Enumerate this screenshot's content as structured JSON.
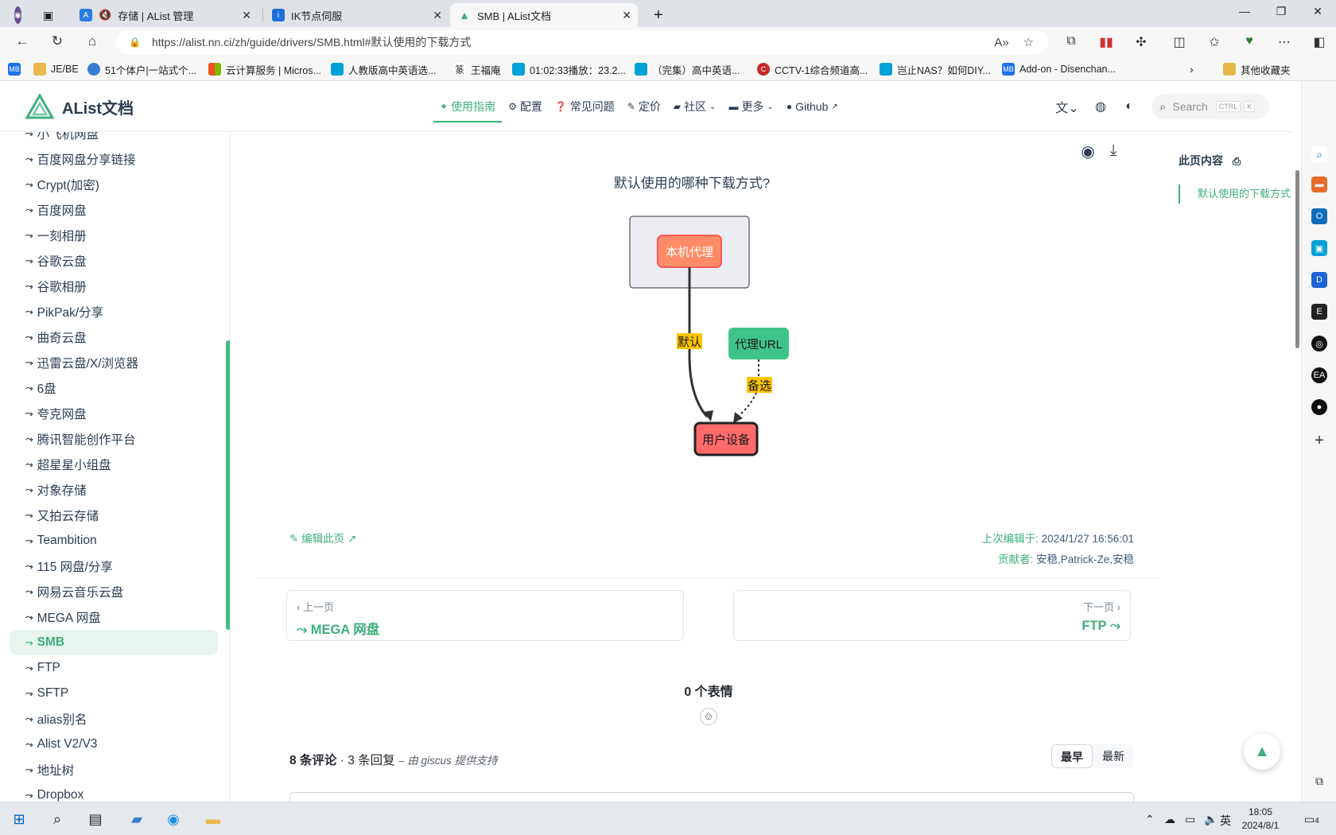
{
  "browser": {
    "tabs": [
      {
        "label": "存储 | AList 管理",
        "active": false
      },
      {
        "label": "IK节点伺服",
        "active": false
      },
      {
        "label": "SMB | AList文档",
        "active": true
      }
    ],
    "url": "https://alist.nn.ci/zh/guide/drivers/SMB.html#默认使用的下载方式",
    "bookmarks": [
      "JE/BE",
      "51个体户|一站式个...",
      "云计算服务 | Micros...",
      "人教版高中英语选...",
      "王福庵",
      "01:02:33播放：23.2...",
      "（完集）高中英语...",
      "CCTV-1综合频道高...",
      "岂止NAS？如何DIY...",
      "Add-on - Disenchan...",
      "其他收藏夹"
    ],
    "bookmark_badge": "MB"
  },
  "site": {
    "logo_text": "AList文档",
    "nav": [
      {
        "label": "使用指南",
        "icon": "lightbulb-icon",
        "active": true
      },
      {
        "label": "配置",
        "icon": "gear-icon"
      },
      {
        "label": "常见问题",
        "icon": "question-icon"
      },
      {
        "label": "定价",
        "icon": "tag-icon"
      },
      {
        "label": "社区",
        "icon": "chat-icon",
        "dropdown": true
      },
      {
        "label": "更多",
        "icon": "message-icon",
        "dropdown": true
      },
      {
        "label": "Github",
        "icon": "github-icon",
        "external": true
      }
    ],
    "search_placeholder": "Search",
    "search_kbd_1": "CTRL",
    "search_kbd_2": "K"
  },
  "sidebar": {
    "items": [
      "小飞机网盘",
      "百度网盘分享链接",
      "Crypt(加密)",
      "百度网盘",
      "一刻相册",
      "谷歌云盘",
      "谷歌相册",
      "PikPak/分享",
      "曲奇云盘",
      "迅雷云盘/X/浏览器",
      "6盘",
      "夸克网盘",
      "腾讯智能创作平台",
      "超星星小组盘",
      "对象存储",
      "又拍云存储",
      "Teambition",
      "115 网盘/分享",
      "网易云音乐云盘",
      "MEGA 网盘",
      "SMB",
      "FTP",
      "SFTP",
      "alias别名",
      "Alist V2/V3",
      "地址树",
      "Dropbox"
    ],
    "active": "SMB"
  },
  "content": {
    "diagram": {
      "title": "默认使用的哪种下载方式?",
      "node_proxy": "本机代理",
      "node_url": "代理URL",
      "node_user": "用户设备",
      "edge_default": "默认",
      "edge_alt": "备选",
      "colors": {
        "proxy": "#ff8c66",
        "url": "#3ec48a",
        "user": "#ff6b6b",
        "label": "#ffc400"
      }
    },
    "edit_link": "编辑此页",
    "last_updated_label": "上次编辑于:",
    "last_updated": "2024/1/27 16:56:01",
    "contributors_label": "贡献者:",
    "contributors": "安稳,Patrick-Ze,安稳",
    "prev_label": "‹ 上一页",
    "prev_title": "MEGA 网盘",
    "next_label": "下一页 ›",
    "next_title": "FTP",
    "reactions": "0 个表情",
    "comments_count": "8 条评论",
    "replies_count": "3 条回复",
    "powered_by": "– 由 giscus 提供支持",
    "sort_oldest": "最早",
    "sort_newest": "最新"
  },
  "toc": {
    "title": "此页内容",
    "items": [
      "默认使用的下载方式"
    ]
  },
  "taskbar": {
    "time": "18:05",
    "date": "2024/8/1",
    "ime": "英",
    "notif_count": "4"
  },
  "accent_color": "#3eaf7c"
}
